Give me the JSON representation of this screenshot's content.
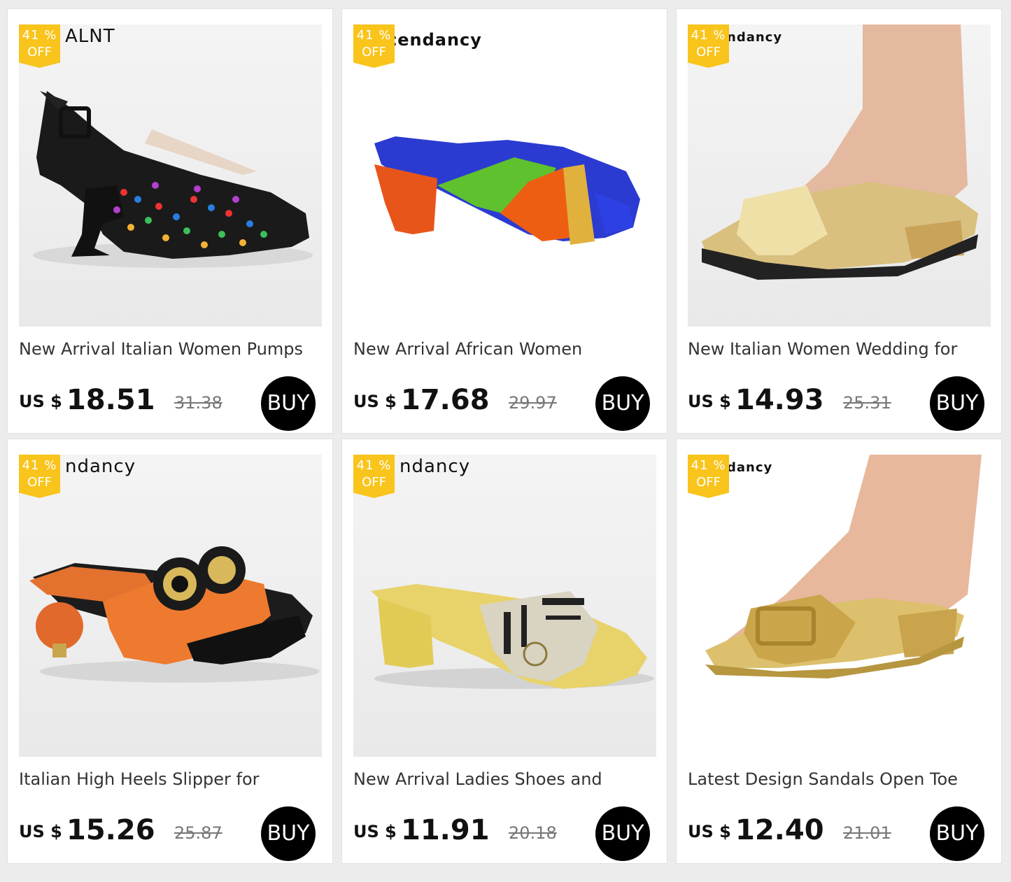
{
  "products": [
    {
      "brand": "ALNT",
      "badge_pct": "41 %",
      "badge_off": "OFF",
      "title": "New Arrival Italian Women Pumps",
      "currency": "US $",
      "price": "18.51",
      "old_price": "31.38",
      "buy_label": "BUY",
      "image": "black-jeweled-slingback-heel-image"
    },
    {
      "brand": "cendancy",
      "badge_pct": "41 %",
      "badge_off": "OFF",
      "title": "New Arrival African Women",
      "currency": "US $",
      "price": "17.68",
      "old_price": "29.97",
      "buy_label": "BUY",
      "image": "colorblock-rhinestone-slide-image"
    },
    {
      "brand": "ndancy",
      "badge_pct": "41 %",
      "badge_off": "OFF",
      "title": "New Italian Women Wedding for",
      "currency": "US $",
      "price": "14.93",
      "old_price": "25.31",
      "buy_label": "BUY",
      "image": "gold-slide-on-foot-image"
    },
    {
      "brand": "ndancy",
      "badge_pct": "41 %",
      "badge_off": "OFF",
      "title": "Italian High Heels  Slipper for",
      "currency": "US $",
      "price": "15.26",
      "old_price": "25.87",
      "buy_label": "BUY",
      "image": "orange-round-heel-slide-image"
    },
    {
      "brand": "ndancy",
      "badge_pct": "41 %",
      "badge_off": "OFF",
      "title": "New Arrival Ladies Shoes and",
      "currency": "US $",
      "price": "11.91",
      "old_price": "20.18",
      "buy_label": "BUY",
      "image": "gold-block-heel-slide-image"
    },
    {
      "brand": "dancy",
      "badge_pct": "41 %",
      "badge_off": "OFF",
      "title": "Latest Design Sandals Open Toe",
      "currency": "US $",
      "price": "12.40",
      "old_price": "21.01",
      "buy_label": "BUY",
      "image": "gold-buckle-slide-on-foot-image"
    }
  ],
  "colors": {
    "badge": "#f9c41b",
    "buy_button": "#000000",
    "page_background": "#ececec"
  }
}
